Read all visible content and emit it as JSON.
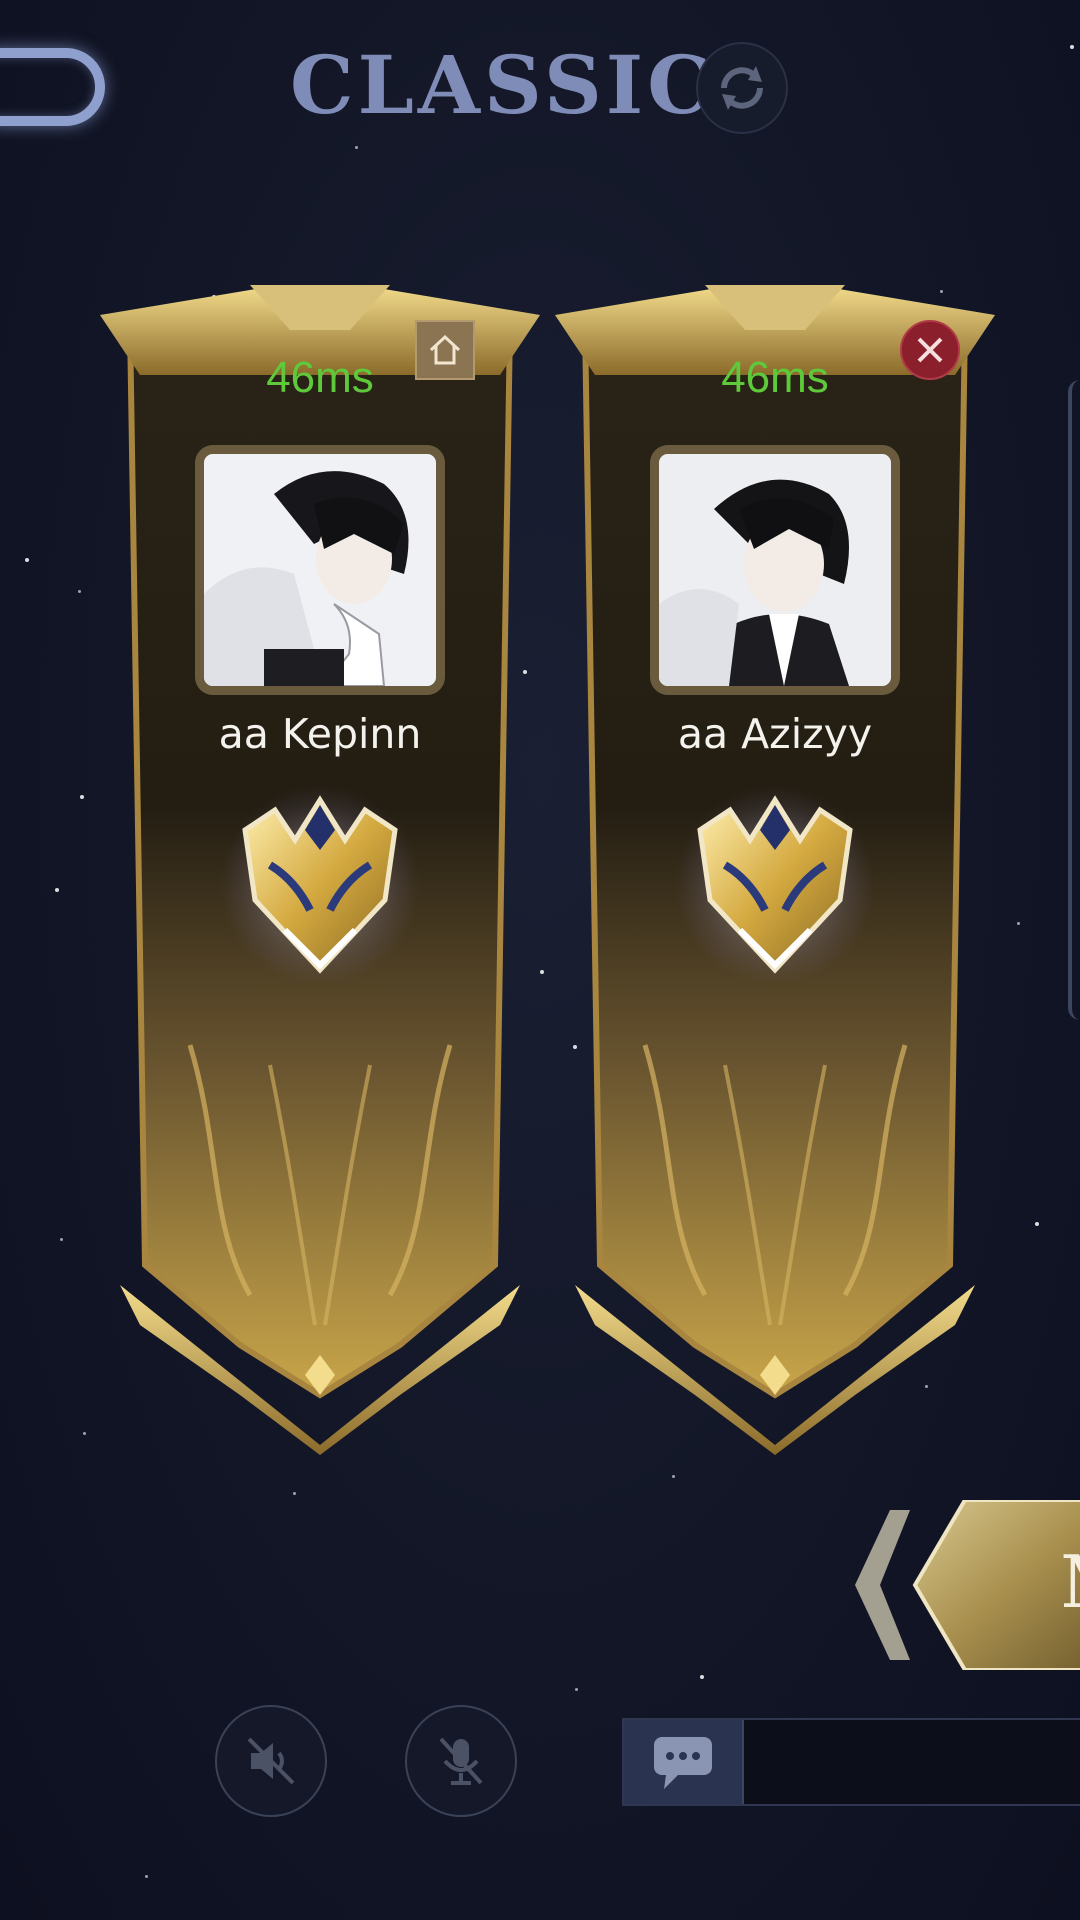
{
  "header": {
    "mode_title": "CLASSIC"
  },
  "players": [
    {
      "ping": "46ms",
      "name": "aa Kepinn",
      "slot_action": "home",
      "avatar": "anime-boy-avatar"
    },
    {
      "ping": "46ms",
      "name": "aa Azizyy",
      "slot_action": "remove",
      "avatar": "anime-boy-avatar"
    }
  ],
  "ready_button": {
    "label": "M"
  },
  "colors": {
    "ping": "#5ec93a",
    "banner_gold": "#c9a64a",
    "title": "#7f8cb7",
    "background": "#121626"
  }
}
